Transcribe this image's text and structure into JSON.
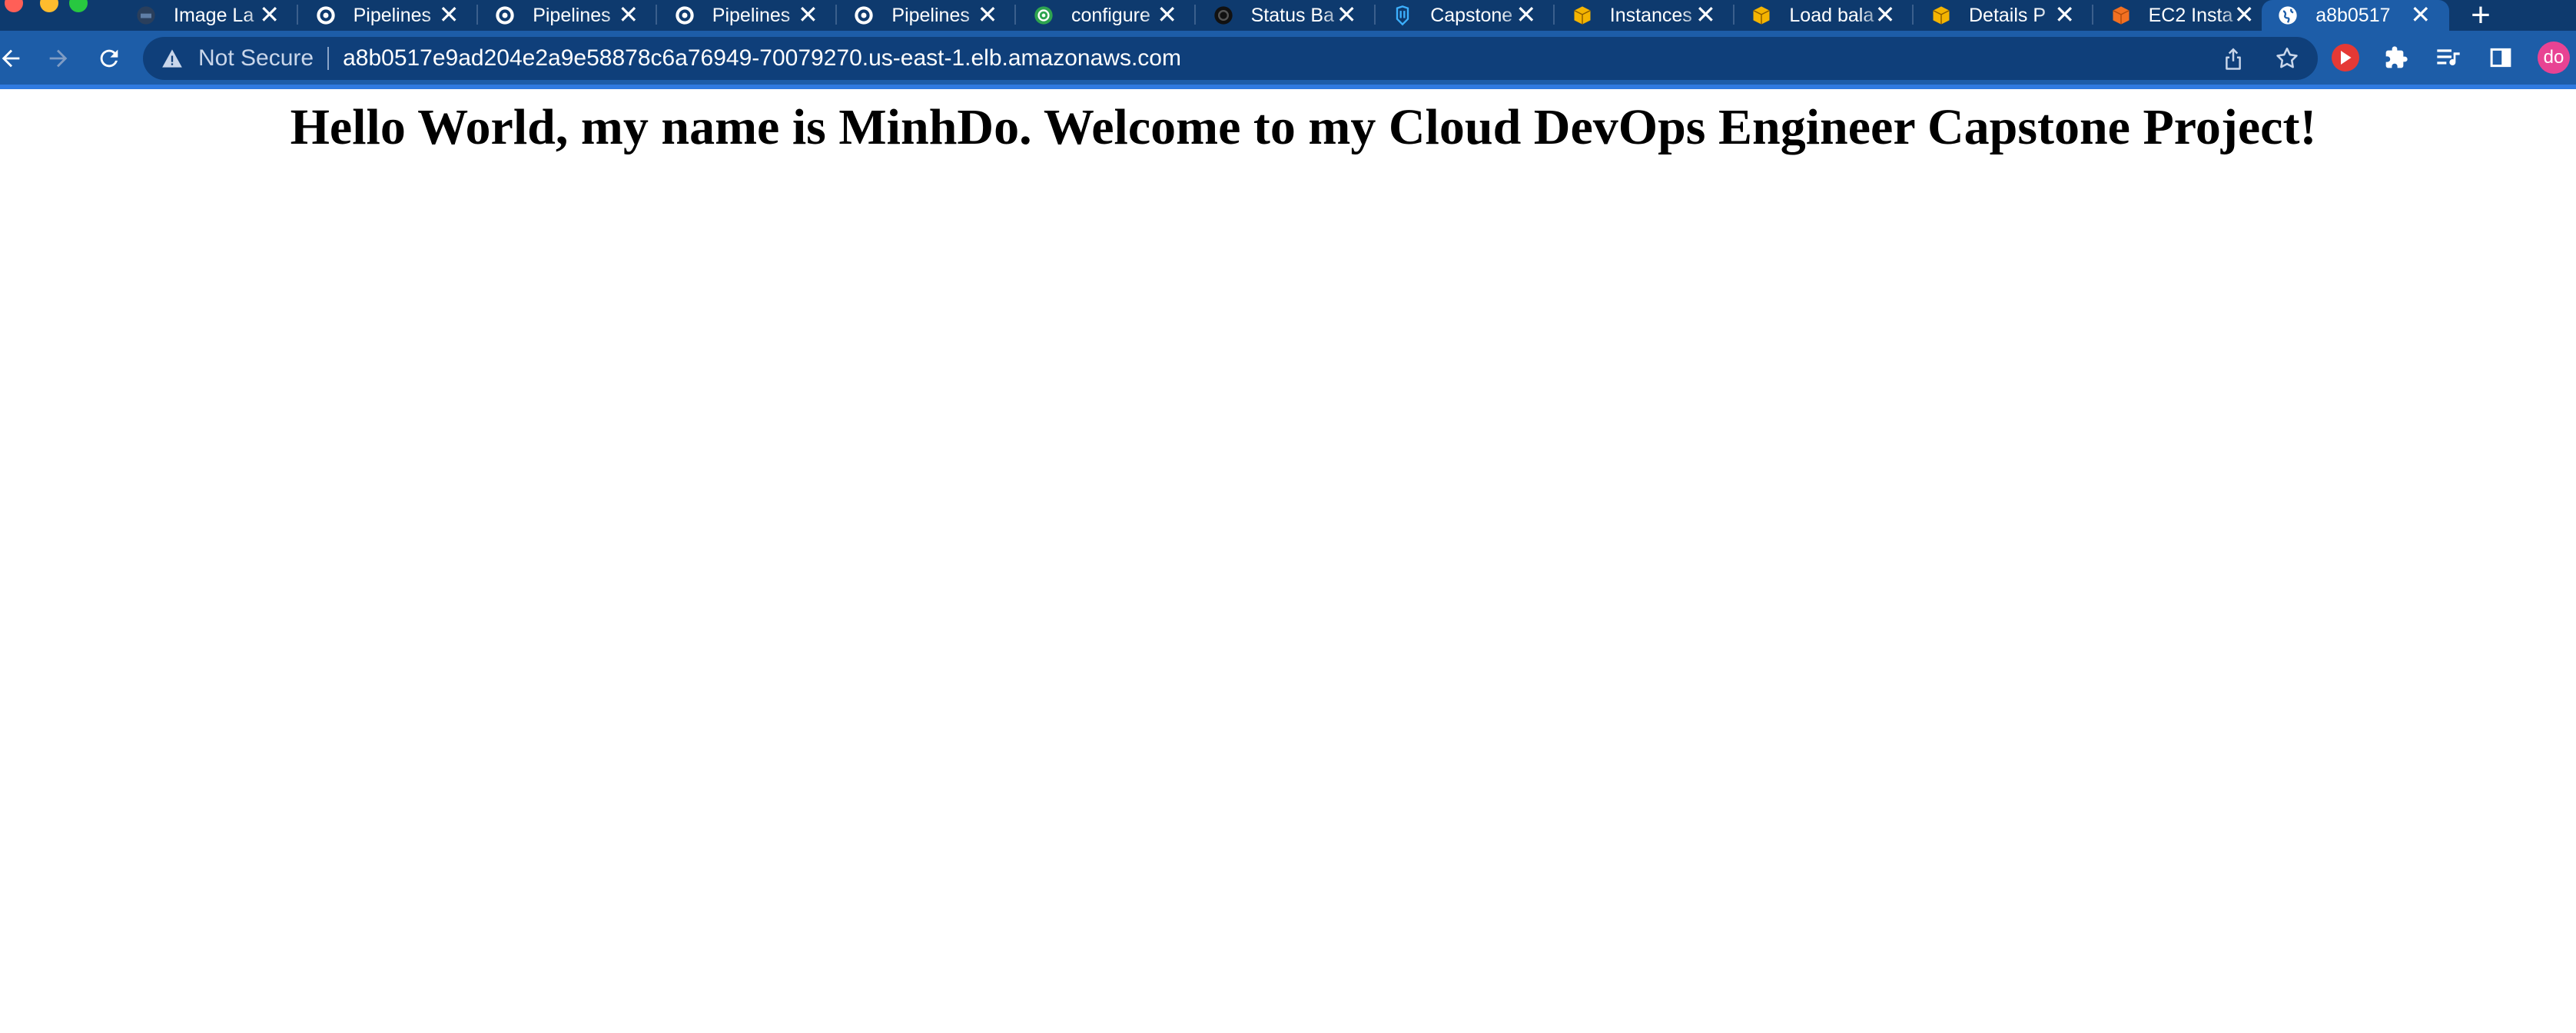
{
  "browser": {
    "tabs": [
      {
        "title": "Image La",
        "favicon": "docker-icon"
      },
      {
        "title": "Pipelines",
        "favicon": "circleci-icon"
      },
      {
        "title": "Pipelines",
        "favicon": "circleci-icon"
      },
      {
        "title": "Pipelines",
        "favicon": "circleci-icon"
      },
      {
        "title": "Pipelines",
        "favicon": "circleci-icon"
      },
      {
        "title": "configure",
        "favicon": "circleci-green-icon"
      },
      {
        "title": "Status Ba",
        "favicon": "github-icon"
      },
      {
        "title": "Capstone",
        "favicon": "udacity-icon"
      },
      {
        "title": "Instances",
        "favicon": "aws-cube-icon"
      },
      {
        "title": "Load bala",
        "favicon": "aws-cube-icon"
      },
      {
        "title": "Details P",
        "favicon": "aws-cube-icon"
      },
      {
        "title": "EC2 Insta",
        "favicon": "ec2-icon"
      },
      {
        "title": "a8b0517",
        "favicon": "globe-icon",
        "active": true
      }
    ],
    "tab_close_glyph": "✕",
    "new_tab_glyph": "+",
    "security_label": "Not Secure",
    "url": "a8b0517e9ad204e2a9e58878c6a76949-70079270.us-east-1.elb.amazonaws.com",
    "profile_initials": "do",
    "colors": {
      "tab_strip": "#0e3a6e",
      "toolbar": "#1d5da8",
      "omnibox": "#0f3f7a",
      "profile": "#e84393"
    }
  },
  "page": {
    "heading": "Hello World, my name is MinhDo. Welcome to my Cloud DevOps Engineer Capstone Project!"
  }
}
